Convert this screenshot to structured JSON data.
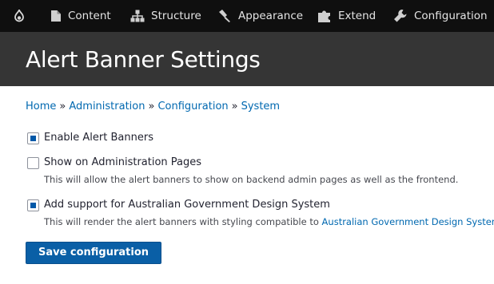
{
  "toolbar": {
    "items": [
      {
        "label": "Content",
        "icon": "file-icon"
      },
      {
        "label": "Structure",
        "icon": "sitemap-icon"
      },
      {
        "label": "Appearance",
        "icon": "paintbrush-icon"
      },
      {
        "label": "Extend",
        "icon": "puzzle-icon"
      },
      {
        "label": "Configuration",
        "icon": "wrench-icon"
      }
    ],
    "home_icon": "drupal-drop-icon"
  },
  "header": {
    "title": "Alert Banner Settings"
  },
  "breadcrumb": {
    "items": [
      "Home",
      "Administration",
      "Configuration",
      "System"
    ],
    "separator": "»"
  },
  "form": {
    "options": [
      {
        "label": "Enable Alert Banners",
        "checked": true,
        "description": ""
      },
      {
        "label": "Show on Administration Pages",
        "checked": false,
        "description": "This will allow the alert banners to show on backend admin pages as well as the frontend."
      },
      {
        "label": "Add support for Australian Government Design System",
        "checked": true,
        "description_prefix": "This will render the alert banners with styling compatible to ",
        "description_link": "Australian Government Design System",
        "description_suffix": "."
      }
    ],
    "submit_label": "Save configuration"
  },
  "colors": {
    "toolbar_bg": "#0f0f0f",
    "header_bg": "#353535",
    "link": "#0068b0",
    "primary_button": "#0a5fa6",
    "checkbox_fill": "#0058a8"
  }
}
